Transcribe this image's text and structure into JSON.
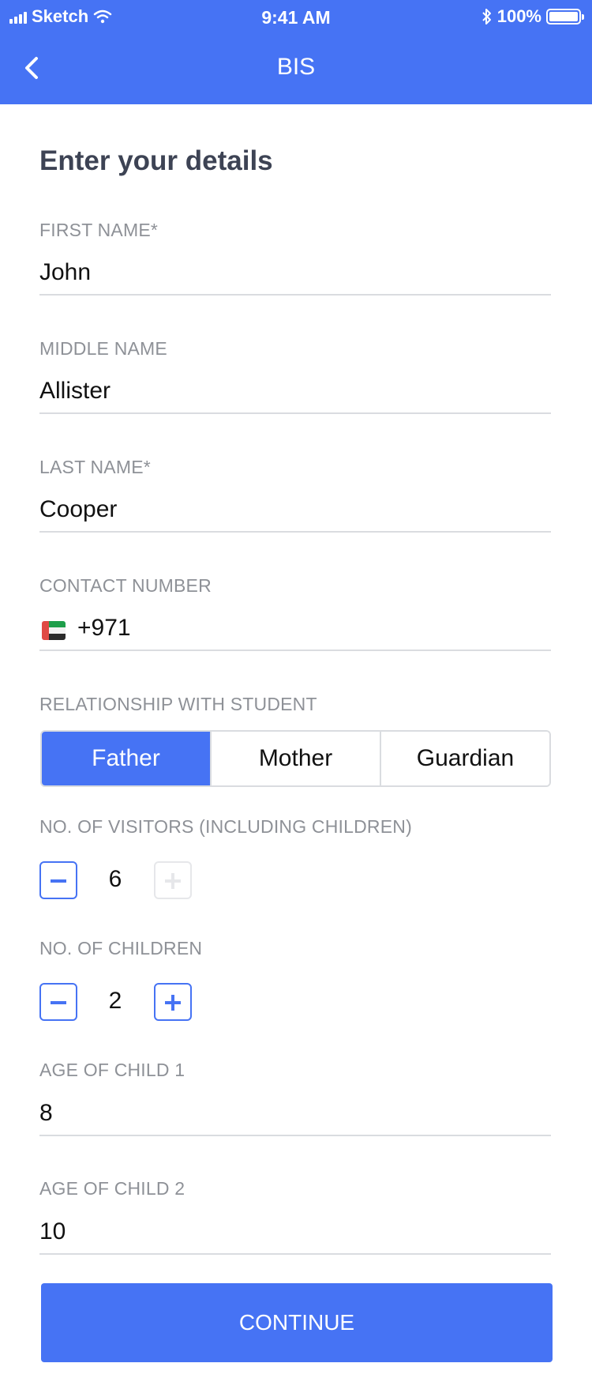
{
  "status_bar": {
    "carrier": "Sketch",
    "time": "9:41 AM",
    "battery": "100%"
  },
  "header": {
    "title": "BIS"
  },
  "form": {
    "heading": "Enter your details",
    "first_name": {
      "label": "FIRST NAME*",
      "value": "John"
    },
    "middle_name": {
      "label": "MIDDLE NAME",
      "value": "Allister"
    },
    "last_name": {
      "label": "LAST NAME*",
      "value": "Cooper"
    },
    "contact": {
      "label": "CONTACT NUMBER",
      "value": "+971"
    },
    "relationship": {
      "label": "RELATIONSHIP WITH STUDENT",
      "options": [
        "Father",
        "Mother",
        "Guardian"
      ],
      "selected": "Father"
    },
    "visitors": {
      "label": "NO. OF VISITORS (INCLUDING CHILDREN)",
      "value": "6"
    },
    "children": {
      "label": "NO. OF CHILDREN",
      "value": "2"
    },
    "age_child_1": {
      "label": "AGE OF CHILD 1",
      "value": "8"
    },
    "age_child_2": {
      "label": "AGE OF CHILD 2",
      "value": "10"
    }
  },
  "actions": {
    "continue_label": "CONTINUE"
  },
  "colors": {
    "accent": "#4673F4",
    "label": "#8E9197",
    "divider": "#DADCE0",
    "heading": "#3D4354"
  },
  "icons": [
    "signal-icon",
    "wifi-icon",
    "bluetooth-icon",
    "battery-icon",
    "back-chevron-icon",
    "uae-flag-icon",
    "minus-icon",
    "plus-icon"
  ]
}
